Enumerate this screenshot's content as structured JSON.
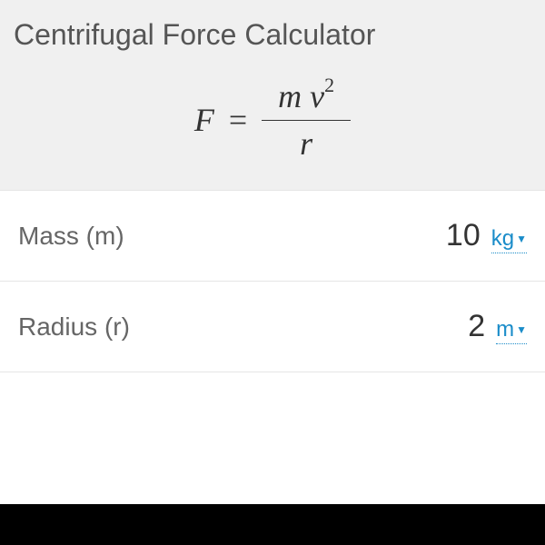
{
  "title": "Centrifugal Force Calculator",
  "formula": {
    "result_var": "F",
    "equals": "=",
    "numerator_var1": "m",
    "numerator_var2": "v",
    "numerator_exp": "2",
    "denominator_var": "r"
  },
  "inputs": [
    {
      "label": "Mass (m)",
      "value": "10",
      "unit": "kg"
    },
    {
      "label": "Radius (r)",
      "value": "2",
      "unit": "m"
    }
  ]
}
